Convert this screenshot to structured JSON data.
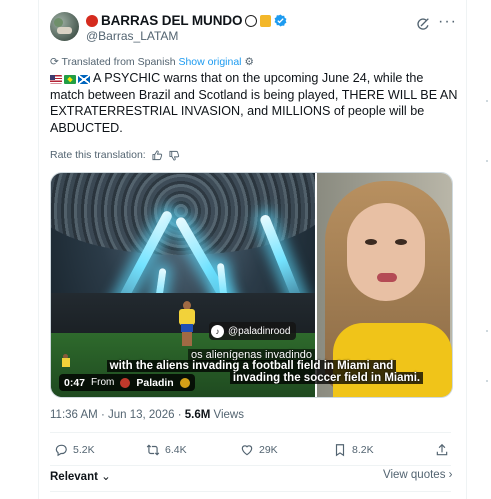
{
  "author": {
    "display_name": "BARRAS DEL MUNDO",
    "handle": "@Barras_LATAM",
    "verified": true
  },
  "translation": {
    "note": "Translated from Spanish",
    "show_original": "Show original",
    "rate_label": "Rate this translation:"
  },
  "tweet": {
    "text": "A PSYCHIC warns that on the upcoming June 24, while the match between Brazil and Scotland is being played, THERE WILL BE AN EXTRATERRESTRIAL INVASION, and MILLIONS of people will be ABDUCTED."
  },
  "media": {
    "watermark": "@paladinrood",
    "caption_original": "os alienígenas invadindo",
    "caption_line1": "with the aliens invading a football field in Miami and",
    "caption_line2": "invading the soccer field in Miami.",
    "duration": "0:47",
    "from_label": "From",
    "source": "Paladin"
  },
  "meta": {
    "time": "11:36 AM",
    "date": "Jun 13, 2026",
    "views_count": "5.6M",
    "views_label": "Views"
  },
  "actions": {
    "replies": "5.2K",
    "reposts": "6.4K",
    "likes": "29K",
    "bookmarks": "8.2K"
  },
  "footer": {
    "sort_label": "Relevant",
    "view_quotes": "View quotes"
  },
  "colors": {
    "accent": "#1d9bf0",
    "secondary_text": "#536471",
    "primary_text": "#0f1419",
    "divider": "#eff3f4"
  }
}
